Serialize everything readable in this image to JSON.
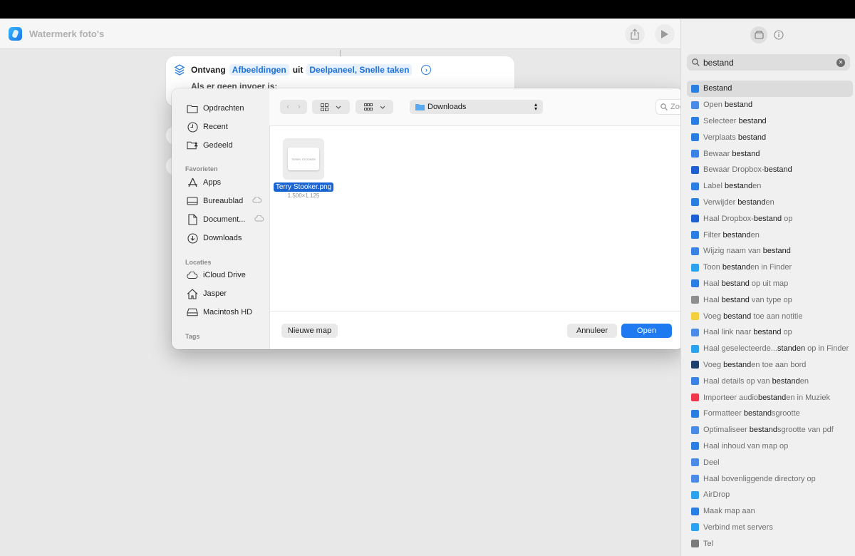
{
  "app": {
    "title": "Watermerk foto's"
  },
  "action": {
    "verb": "Ontvang",
    "input_types": "Afbeeldingen",
    "from_word": "uit",
    "sources": "Deelpaneel, Snelle taken",
    "no_input_label": "Als er geen invoer is:"
  },
  "dialog": {
    "sidebar": {
      "top_items": [
        {
          "label": "Opdrachten",
          "icon": "folder-icon"
        },
        {
          "label": "Recent",
          "icon": "clock-icon"
        },
        {
          "label": "Gedeeld",
          "icon": "shared-folder-icon"
        }
      ],
      "favorites_heading": "Favorieten",
      "favorites": [
        {
          "label": "Apps",
          "icon": "apps-icon"
        },
        {
          "label": "Bureaublad",
          "icon": "desktop-icon"
        },
        {
          "label": "Document...",
          "icon": "document-icon"
        },
        {
          "label": "Downloads",
          "icon": "downloads-icon"
        }
      ],
      "locations_heading": "Locaties",
      "locations": [
        {
          "label": "iCloud Drive",
          "icon": "cloud-icon"
        },
        {
          "label": "Jasper",
          "icon": "home-icon"
        },
        {
          "label": "Macintosh HD",
          "icon": "drive-icon"
        }
      ],
      "tags_heading": "Tags"
    },
    "location": "Downloads",
    "search_placeholder": "Zoek",
    "file": {
      "name": "Terry Stooker.png",
      "dimensions": "1.500×1.125",
      "thumb_text": "TERRY STOOKER"
    },
    "new_folder_label": "Nieuwe map",
    "cancel_label": "Annuleer",
    "open_label": "Open"
  },
  "library": {
    "search_value": "bestand",
    "items": [
      {
        "pre": "",
        "match": "Bestand",
        "post": "",
        "color": "#2a7de1",
        "selected": true
      },
      {
        "pre": "Open ",
        "match": "bestand",
        "post": "",
        "color": "#4b8be8"
      },
      {
        "pre": "Selecteer ",
        "match": "bestand",
        "post": "",
        "color": "#2a7de1"
      },
      {
        "pre": "Verplaats ",
        "match": "bestand",
        "post": "",
        "color": "#2a7de1"
      },
      {
        "pre": "Bewaar ",
        "match": "bestand",
        "post": "",
        "color": "#3b82e6"
      },
      {
        "pre": "Bewaar Dropbox-",
        "match": "bestand",
        "post": "",
        "color": "#1f5fd1"
      },
      {
        "pre": "Label ",
        "match": "bestand",
        "post": "en",
        "color": "#2a7de1"
      },
      {
        "pre": "Verwijder ",
        "match": "bestand",
        "post": "en",
        "color": "#2a7de1"
      },
      {
        "pre": "Haal Dropbox-",
        "match": "bestand",
        "post": " op",
        "color": "#1f5fd1"
      },
      {
        "pre": "Filter ",
        "match": "bestand",
        "post": "en",
        "color": "#2a7de1"
      },
      {
        "pre": "Wijzig naam van ",
        "match": "bestand",
        "post": "",
        "color": "#3b82e6"
      },
      {
        "pre": "Toon ",
        "match": "bestand",
        "post": "en in Finder",
        "color": "#2aa2f0"
      },
      {
        "pre": "Haal ",
        "match": "bestand",
        "post": " op uit map",
        "color": "#2a7de1"
      },
      {
        "pre": "Haal ",
        "match": "bestand",
        "post": " van type op",
        "color": "#8e8e8e"
      },
      {
        "pre": "Voeg ",
        "match": "bestand",
        "post": " toe aan notitie",
        "color": "#f5cf3d"
      },
      {
        "pre": "Haal link naar ",
        "match": "bestand",
        "post": " op",
        "color": "#4b8be8"
      },
      {
        "pre": "Haal geselecteerde...",
        "match": "standen",
        "post": " op in Finder",
        "color": "#2aa2f0"
      },
      {
        "pre": "Voeg ",
        "match": "bestand",
        "post": "en toe aan bord",
        "color": "#1c3f6b"
      },
      {
        "pre": "Haal details op van ",
        "match": "bestand",
        "post": "en",
        "color": "#3b82e6"
      },
      {
        "pre": "Importeer audio",
        "match": "bestand",
        "post": "en in Muziek",
        "color": "#f0364a"
      },
      {
        "pre": "Formatteer ",
        "match": "bestand",
        "post": "sgrootte",
        "color": "#2a7de1"
      },
      {
        "pre": "Optimaliseer ",
        "match": "bestand",
        "post": "sgrootte van pdf",
        "color": "#4b8be8"
      },
      {
        "pre": "Haal inhoud van map op",
        "match": "",
        "post": "",
        "color": "#2a7de1"
      },
      {
        "pre": "Deel",
        "match": "",
        "post": "",
        "color": "#4b8be8"
      },
      {
        "pre": "Haal bovenliggende directory op",
        "match": "",
        "post": "",
        "color": "#4b8be8"
      },
      {
        "pre": "AirDrop",
        "match": "",
        "post": "",
        "color": "#2aa2f0"
      },
      {
        "pre": "Maak map aan",
        "match": "",
        "post": "",
        "color": "#2a7de1"
      },
      {
        "pre": "Verbind met servers",
        "match": "",
        "post": "",
        "color": "#2aa2f0"
      },
      {
        "pre": "Tel",
        "match": "",
        "post": "",
        "color": "#7a7a7a"
      }
    ]
  }
}
